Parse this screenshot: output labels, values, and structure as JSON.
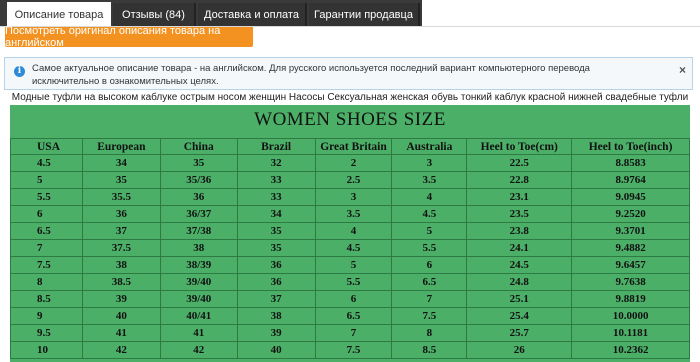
{
  "tabs": [
    {
      "label": "Описание товара",
      "active": true
    },
    {
      "label": "Отзывы (84)",
      "active": false
    },
    {
      "label": "Доставка и оплата",
      "active": false
    },
    {
      "label": "Гарантии продавца",
      "active": false
    }
  ],
  "original_button": "Посмотреть оригинал описания товара на английском",
  "notice": {
    "icon": "info-icon",
    "text": "Самое актуальное описание товара - на английском. Для русского используется последний вариант компьютерного перевода исключительно в ознакомительных целях.",
    "close": "×"
  },
  "product_description": "Модные туфли на высоком каблуке острым носом женщин Насосы Сексуальная женская обувь тонкий каблук красной нижней свадебные туфли",
  "size_chart": {
    "title": "WOMEN SHOES SIZE",
    "headers": [
      "USA",
      "European",
      "China",
      "Brazil",
      "Great Britain",
      "Australia",
      "Heel to Toe(cm)",
      "Heel to Toe(inch)"
    ],
    "rows": [
      [
        "4.5",
        "34",
        "35",
        "32",
        "2",
        "3",
        "22.5",
        "8.8583"
      ],
      [
        "5",
        "35",
        "35/36",
        "33",
        "2.5",
        "3.5",
        "22.8",
        "8.9764"
      ],
      [
        "5.5",
        "35.5",
        "36",
        "33",
        "3",
        "4",
        "23.1",
        "9.0945"
      ],
      [
        "6",
        "36",
        "36/37",
        "34",
        "3.5",
        "4.5",
        "23.5",
        "9.2520"
      ],
      [
        "6.5",
        "37",
        "37/38",
        "35",
        "4",
        "5",
        "23.8",
        "9.3701"
      ],
      [
        "7",
        "37.5",
        "38",
        "35",
        "4.5",
        "5.5",
        "24.1",
        "9.4882"
      ],
      [
        "7.5",
        "38",
        "38/39",
        "36",
        "5",
        "6",
        "24.5",
        "9.6457"
      ],
      [
        "8",
        "38.5",
        "39/40",
        "36",
        "5.5",
        "6.5",
        "24.8",
        "9.7638"
      ],
      [
        "8.5",
        "39",
        "39/40",
        "37",
        "6",
        "7",
        "25.1",
        "9.8819"
      ],
      [
        "9",
        "40",
        "40/41",
        "38",
        "6.5",
        "7.5",
        "25.4",
        "10.0000"
      ],
      [
        "9.5",
        "41",
        "41",
        "39",
        "7",
        "8",
        "25.7",
        "10.1181"
      ],
      [
        "10",
        "42",
        "42",
        "40",
        "7.5",
        "8.5",
        "26",
        "10.2362"
      ]
    ]
  },
  "colors": {
    "tab_dark": "#333333",
    "accent_orange": "#f39221",
    "notice_border": "#b7d3ea",
    "info_blue": "#2d8bd8",
    "chart_green": "#4caf68"
  }
}
